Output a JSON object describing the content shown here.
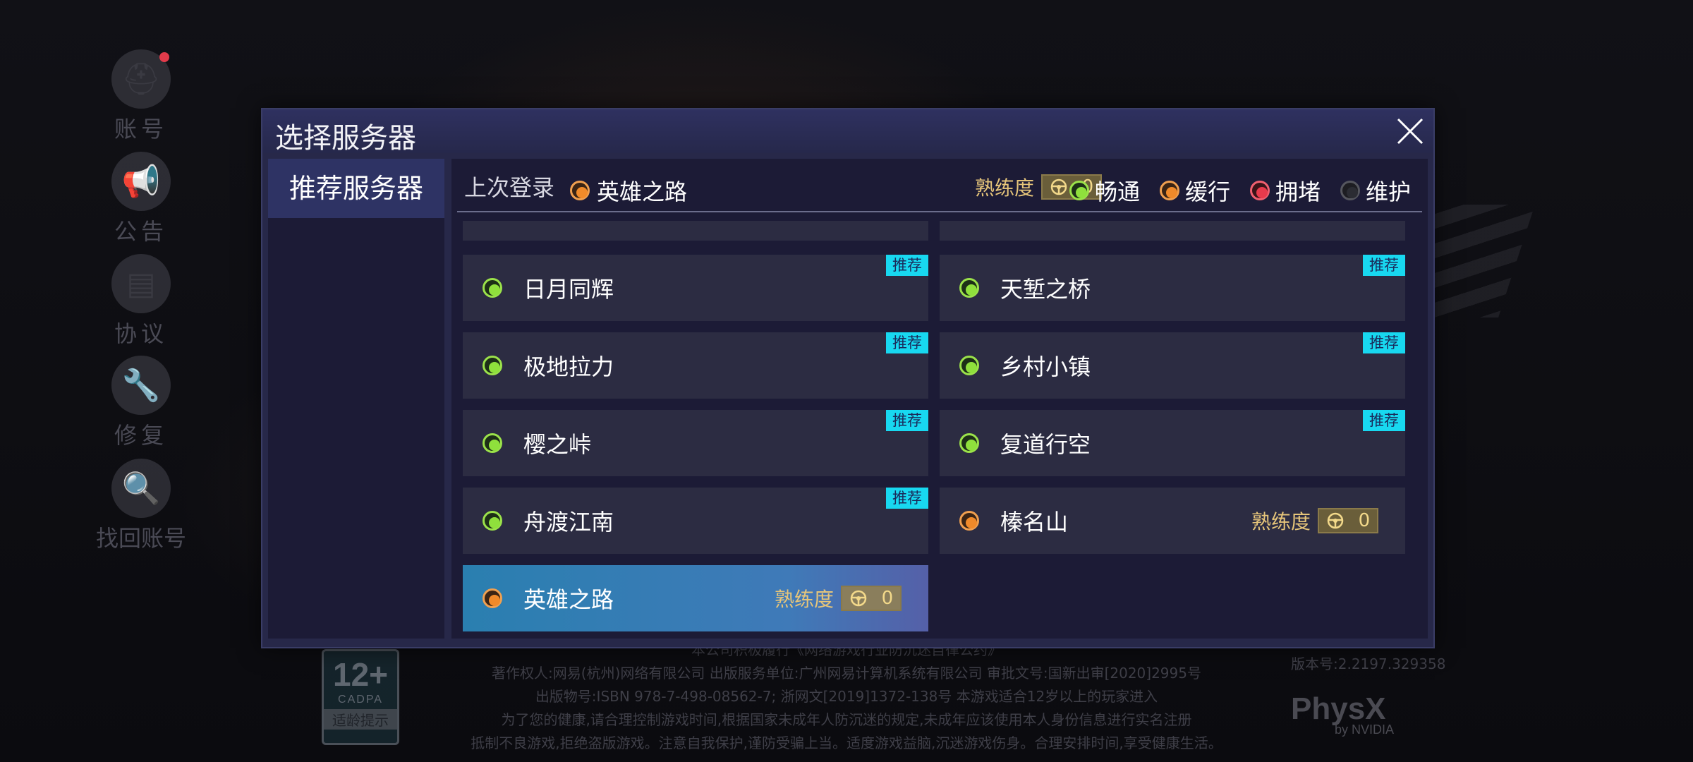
{
  "background": {
    "side_menu": [
      {
        "label": "账号",
        "icon": "helmet-icon",
        "badge": true
      },
      {
        "label": "公告",
        "icon": "megaphone-icon",
        "badge": false
      },
      {
        "label": "协议",
        "icon": "document-icon",
        "badge": false
      },
      {
        "label": "修复",
        "icon": "wrench-icon",
        "badge": false
      },
      {
        "label": "找回账号",
        "icon": "search-helmet-icon",
        "badge": false
      }
    ],
    "footer": {
      "age_rating": "12+",
      "age_org": "CADPA",
      "age_tip": "适龄提示",
      "lines": [
        "本公司积极履行《网络游戏行业防沉迷自律公约》",
        "著作权人:网易(杭州)网络有限公司  出版服务单位:广州网易计算机系统有限公司  审批文号:国新出审[2020]2995号",
        "出版物号:ISBN 978-7-498-08562-7;    浙网文[2019]1372-138号  本游戏适合12岁以上的玩家进入",
        "为了您的健康,请合理控制游戏时间,根据国家未成年人防沉迷的规定,未成年应该使用本人身份信息进行实名注册",
        "抵制不良游戏,拒绝盗版游戏。注意自我保护,谨防受骗上当。适度游戏益脑,沉迷游戏伤身。合理安排时间,享受健康生活。"
      ],
      "version": "版本号:2.2197.329358",
      "physx": "PhysX",
      "physx_sub": "by NVIDIA"
    }
  },
  "dialog": {
    "title": "选择服务器",
    "close_icon": "close-icon",
    "tab": "推荐服务器",
    "last_login_label": "上次登录",
    "last_login_server": "英雄之路",
    "last_login_status": "orange",
    "proficiency_label": "熟练度",
    "proficiency_value": "0",
    "legend": [
      {
        "label": "畅通",
        "status": "green"
      },
      {
        "label": "缓行",
        "status": "orange"
      },
      {
        "label": "拥堵",
        "status": "red"
      },
      {
        "label": "维护",
        "status": "gray"
      }
    ],
    "rec_tag": "推荐",
    "servers": [
      {
        "name": "日月同辉",
        "status": "green",
        "recommended": true
      },
      {
        "name": "天堑之桥",
        "status": "green",
        "recommended": true
      },
      {
        "name": "极地拉力",
        "status": "green",
        "recommended": true
      },
      {
        "name": "乡村小镇",
        "status": "green",
        "recommended": true
      },
      {
        "name": "樱之峠",
        "status": "green",
        "recommended": true
      },
      {
        "name": "复道行空",
        "status": "green",
        "recommended": true
      },
      {
        "name": "舟渡江南",
        "status": "green",
        "recommended": true
      },
      {
        "name": "榛名山",
        "status": "orange",
        "recommended": false,
        "proficiency": "0"
      },
      {
        "name": "英雄之路",
        "status": "orange",
        "recommended": false,
        "proficiency": "0",
        "selected": true
      }
    ],
    "colors": {
      "green": "#8fe03c",
      "orange": "#f08a2a",
      "red": "#e83a4c",
      "gray": "#2b2c33",
      "tag": "#18d8f0"
    }
  }
}
